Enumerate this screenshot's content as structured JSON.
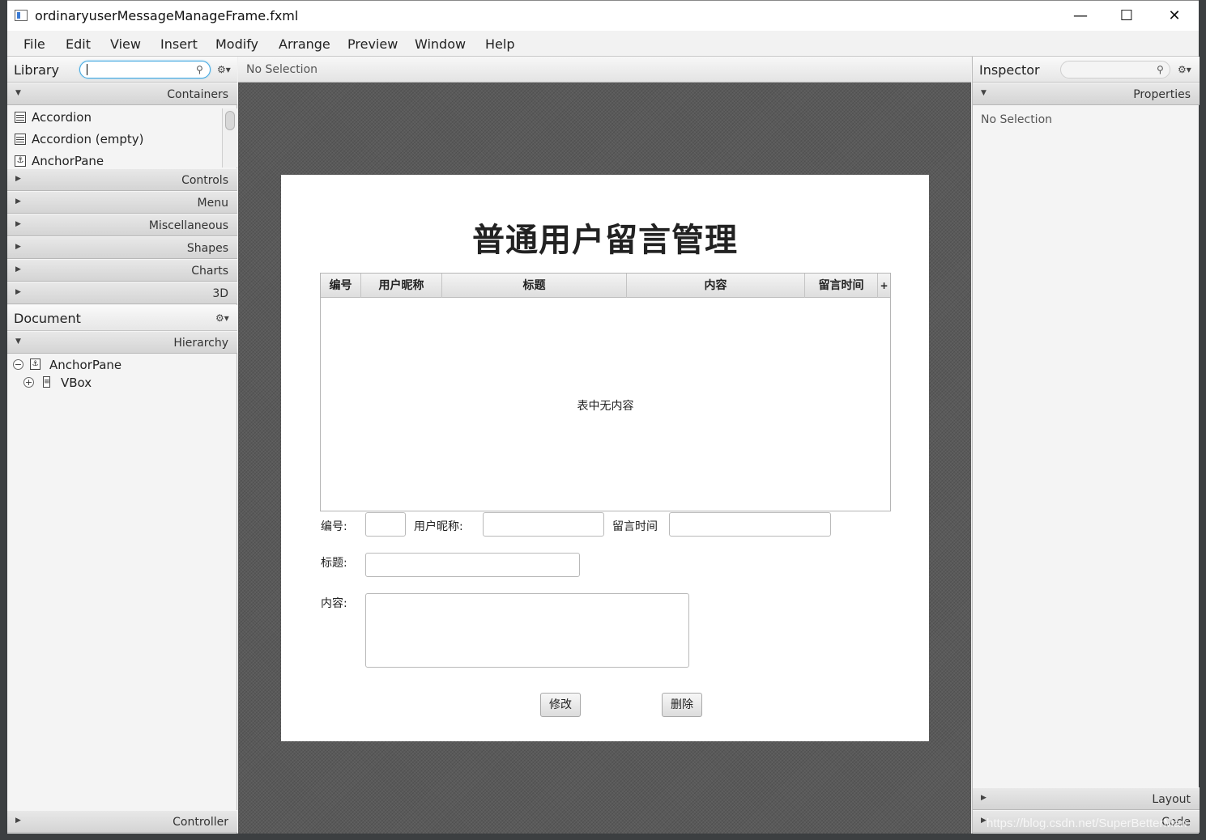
{
  "window": {
    "title": "ordinaryuserMessageManageFrame.fxml",
    "controls": {
      "minimize": "—",
      "maximize": "☐",
      "close": "✕"
    }
  },
  "menu": [
    "File",
    "Edit",
    "View",
    "Insert",
    "Modify",
    "Arrange",
    "Preview",
    "Window",
    "Help"
  ],
  "library": {
    "title": "Library",
    "search_value": "",
    "sections": {
      "containers": "Containers",
      "controls": "Controls",
      "menu": "Menu",
      "misc": "Miscellaneous",
      "shapes": "Shapes",
      "charts": "Charts",
      "three_d": "3D"
    },
    "items": [
      "Accordion",
      "Accordion  (empty)",
      "AnchorPane"
    ]
  },
  "document": {
    "title": "Document",
    "hierarchy_label": "Hierarchy",
    "tree": [
      "AnchorPane",
      "VBox"
    ],
    "controller_label": "Controller"
  },
  "center": {
    "status": "No Selection"
  },
  "form": {
    "heading": "普通用户留言管理",
    "columns": [
      "编号",
      "用户昵称",
      "标题",
      "内容",
      "留言时间"
    ],
    "empty_text": "表中无内容",
    "labels": {
      "id": "编号:",
      "nickname": "用户昵称:",
      "time": "留言时间",
      "title": "标题:",
      "content": "内容:"
    },
    "buttons": {
      "modify": "修改",
      "delete": "删除"
    }
  },
  "inspector": {
    "title": "Inspector",
    "properties_label": "Properties",
    "status": "No Selection",
    "layout_label": "Layout",
    "code_label": "Code"
  },
  "watermark": "https://blog.csdn.net/SuperBetterMan"
}
